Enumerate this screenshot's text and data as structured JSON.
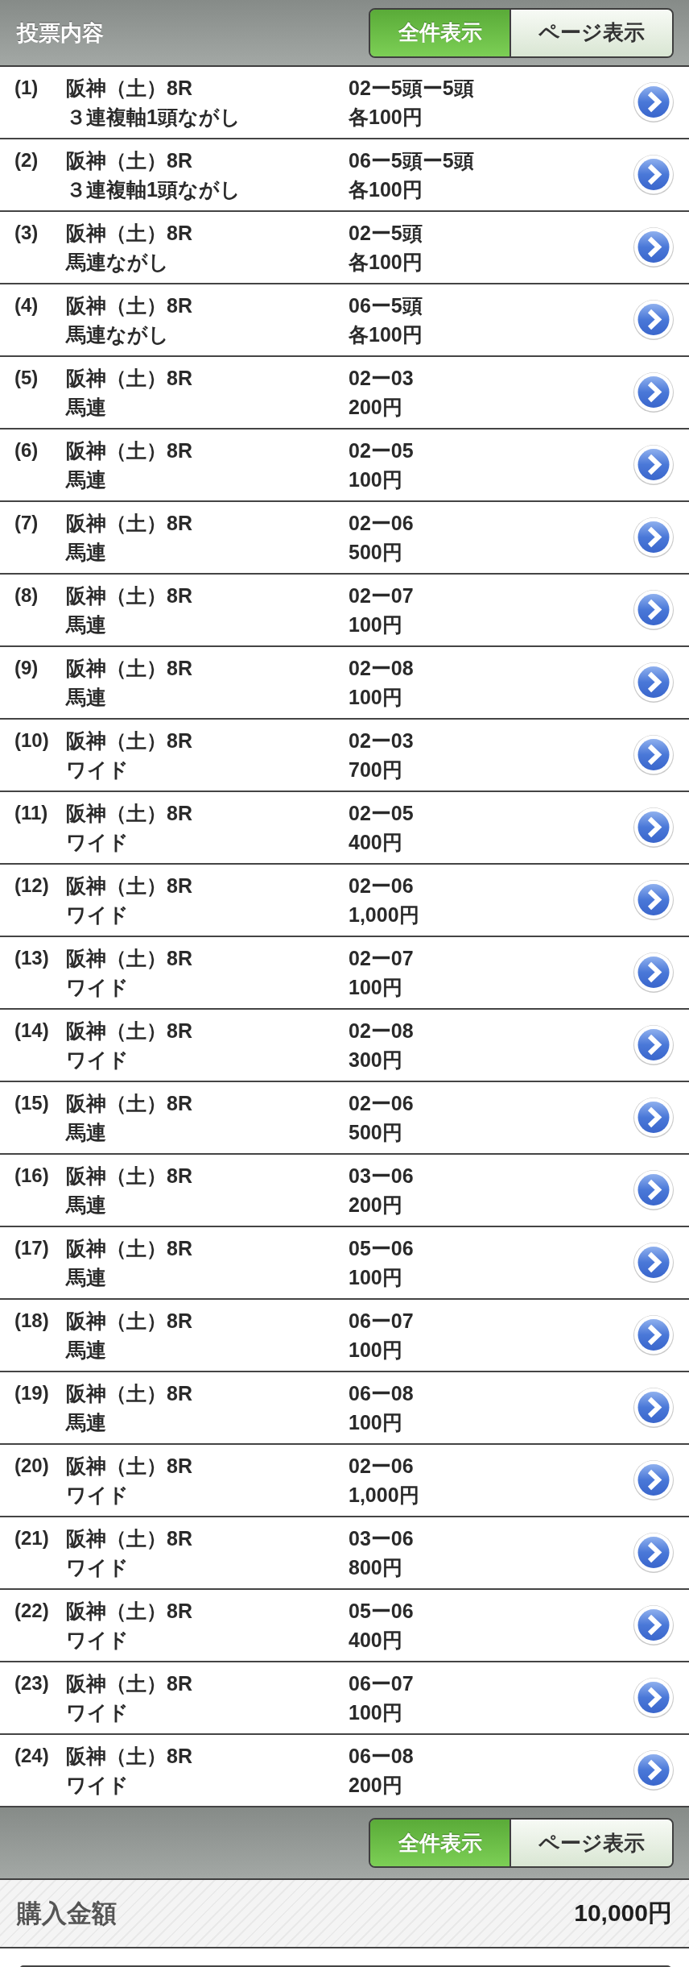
{
  "header": {
    "title": "投票内容",
    "view_toggle": [
      {
        "label": "全件表示",
        "selected": true
      },
      {
        "label": "ページ表示",
        "selected": false
      }
    ]
  },
  "bets": [
    {
      "number": "(1)",
      "race": "阪神（土）8R",
      "bet_type": "３連複軸1頭ながし",
      "combination": "02ー5頭ー5頭",
      "amount": "各100円"
    },
    {
      "number": "(2)",
      "race": "阪神（土）8R",
      "bet_type": "３連複軸1頭ながし",
      "combination": "06ー5頭ー5頭",
      "amount": "各100円"
    },
    {
      "number": "(3)",
      "race": "阪神（土）8R",
      "bet_type": "馬連ながし",
      "combination": "02ー5頭",
      "amount": "各100円"
    },
    {
      "number": "(4)",
      "race": "阪神（土）8R",
      "bet_type": "馬連ながし",
      "combination": "06ー5頭",
      "amount": "各100円"
    },
    {
      "number": "(5)",
      "race": "阪神（土）8R",
      "bet_type": "馬連",
      "combination": "02ー03",
      "amount": "200円"
    },
    {
      "number": "(6)",
      "race": "阪神（土）8R",
      "bet_type": "馬連",
      "combination": "02ー05",
      "amount": "100円"
    },
    {
      "number": "(7)",
      "race": "阪神（土）8R",
      "bet_type": "馬連",
      "combination": "02ー06",
      "amount": "500円"
    },
    {
      "number": "(8)",
      "race": "阪神（土）8R",
      "bet_type": "馬連",
      "combination": "02ー07",
      "amount": "100円"
    },
    {
      "number": "(9)",
      "race": "阪神（土）8R",
      "bet_type": "馬連",
      "combination": "02ー08",
      "amount": "100円"
    },
    {
      "number": "(10)",
      "race": "阪神（土）8R",
      "bet_type": "ワイド",
      "combination": "02ー03",
      "amount": "700円"
    },
    {
      "number": "(11)",
      "race": "阪神（土）8R",
      "bet_type": "ワイド",
      "combination": "02ー05",
      "amount": "400円"
    },
    {
      "number": "(12)",
      "race": "阪神（土）8R",
      "bet_type": "ワイド",
      "combination": "02ー06",
      "amount": "1,000円"
    },
    {
      "number": "(13)",
      "race": "阪神（土）8R",
      "bet_type": "ワイド",
      "combination": "02ー07",
      "amount": "100円"
    },
    {
      "number": "(14)",
      "race": "阪神（土）8R",
      "bet_type": "ワイド",
      "combination": "02ー08",
      "amount": "300円"
    },
    {
      "number": "(15)",
      "race": "阪神（土）8R",
      "bet_type": "馬連",
      "combination": "02ー06",
      "amount": "500円"
    },
    {
      "number": "(16)",
      "race": "阪神（土）8R",
      "bet_type": "馬連",
      "combination": "03ー06",
      "amount": "200円"
    },
    {
      "number": "(17)",
      "race": "阪神（土）8R",
      "bet_type": "馬連",
      "combination": "05ー06",
      "amount": "100円"
    },
    {
      "number": "(18)",
      "race": "阪神（土）8R",
      "bet_type": "馬連",
      "combination": "06ー07",
      "amount": "100円"
    },
    {
      "number": "(19)",
      "race": "阪神（土）8R",
      "bet_type": "馬連",
      "combination": "06ー08",
      "amount": "100円"
    },
    {
      "number": "(20)",
      "race": "阪神（土）8R",
      "bet_type": "ワイド",
      "combination": "02ー06",
      "amount": "1,000円"
    },
    {
      "number": "(21)",
      "race": "阪神（土）8R",
      "bet_type": "ワイド",
      "combination": "03ー06",
      "amount": "800円"
    },
    {
      "number": "(22)",
      "race": "阪神（土）8R",
      "bet_type": "ワイド",
      "combination": "05ー06",
      "amount": "400円"
    },
    {
      "number": "(23)",
      "race": "阪神（土）8R",
      "bet_type": "ワイド",
      "combination": "06ー07",
      "amount": "100円"
    },
    {
      "number": "(24)",
      "race": "阪神（土）8R",
      "bet_type": "ワイド",
      "combination": "06ー08",
      "amount": "200円"
    }
  ],
  "footer_toolbar": {
    "view_toggle": [
      {
        "label": "全件表示",
        "selected": true
      },
      {
        "label": "ページ表示",
        "selected": false
      }
    ]
  },
  "total": {
    "label": "購入金額",
    "amount": "10,000円"
  }
}
